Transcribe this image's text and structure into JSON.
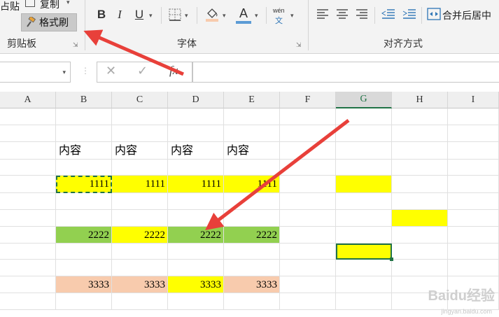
{
  "ribbon": {
    "clipboard": {
      "paste_partial": "占贴",
      "copy_label": "复制",
      "format_painter_label": "格式刷",
      "group_label": "剪贴板"
    },
    "font": {
      "bold": "B",
      "italic": "I",
      "underline": "U",
      "font_color_glyph": "A",
      "phonetic_top": "wén",
      "phonetic_bottom": "文",
      "group_label": "字体"
    },
    "alignment": {
      "merge_center_label": "合并后居中",
      "group_label": "对齐方式"
    }
  },
  "formula_bar": {
    "name_box": "",
    "fx_label": "fx",
    "formula": ""
  },
  "columns": [
    "A",
    "B",
    "C",
    "D",
    "E",
    "F",
    "G",
    "H",
    "I"
  ],
  "active_column": "G",
  "rows": {
    "header_row": [
      "内容",
      "内容",
      "内容",
      "内容"
    ],
    "row_1111": [
      "1111",
      "1111",
      "1111",
      "1111"
    ],
    "row_2222": [
      "2222",
      "2222",
      "2222",
      "2222"
    ],
    "row_3333": [
      "3333",
      "3333",
      "3333",
      "3333"
    ]
  },
  "colors": {
    "yellow": "#ffff00",
    "green": "#92d050",
    "peach": "#f8cbad",
    "excel_green": "#217346",
    "arrow_red": "#e8403a"
  },
  "watermark": {
    "brand": "Baidu经验",
    "url": "jingyan.baidu.com"
  }
}
